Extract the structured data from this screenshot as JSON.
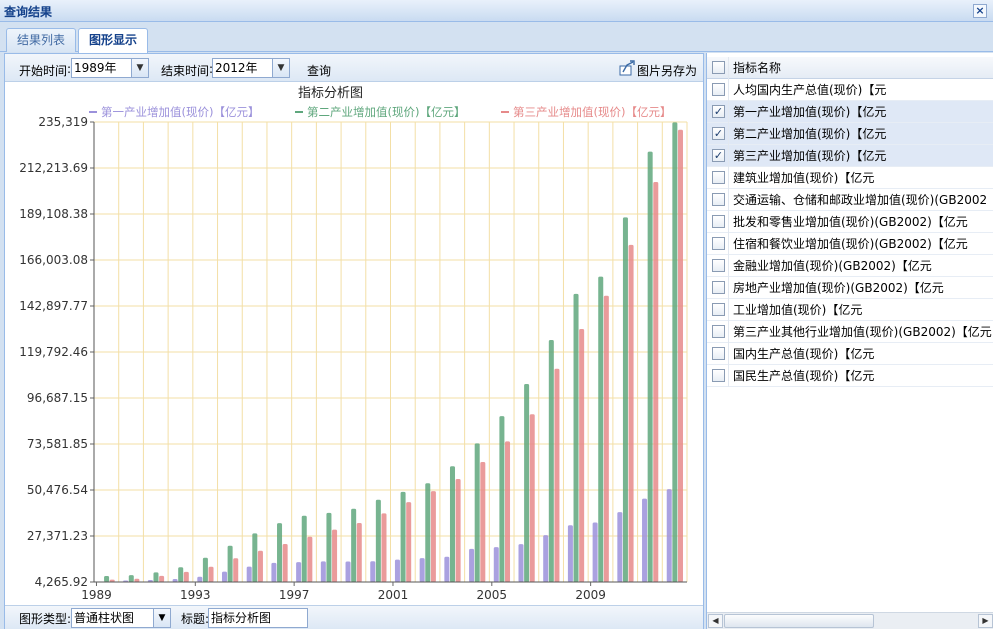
{
  "window": {
    "title": "查询结果",
    "close_icon": "close-icon"
  },
  "tabs": [
    {
      "label": "结果列表",
      "active": false
    },
    {
      "label": "图形显示",
      "active": true
    }
  ],
  "toolbar": {
    "start_label": "开始时间",
    "start_value": "1989年",
    "end_label": "结束时间",
    "end_value": "2012年",
    "query_label": "查询",
    "save_label": "图片另存为",
    "save_icon": "save-image-icon"
  },
  "bottombar": {
    "type_label": "图形类型:",
    "type_value": "普通柱状图",
    "title_label": "标题:",
    "title_value": "指标分析图"
  },
  "indicator_list": {
    "header": "指标名称",
    "items": [
      {
        "name": "人均国内生产总值(现价)【元",
        "checked": false
      },
      {
        "name": "第一产业增加值(现价)【亿元",
        "checked": true
      },
      {
        "name": "第二产业增加值(现价)【亿元",
        "checked": true
      },
      {
        "name": "第三产业增加值(现价)【亿元",
        "checked": true
      },
      {
        "name": "建筑业增加值(现价)【亿元",
        "checked": false
      },
      {
        "name": "交通运输、仓储和邮政业增加值(现价)(GB2002",
        "checked": false
      },
      {
        "name": "批发和零售业增加值(现价)(GB2002)【亿元",
        "checked": false
      },
      {
        "name": "住宿和餐饮业增加值(现价)(GB2002)【亿元",
        "checked": false
      },
      {
        "name": "金融业增加值(现价)(GB2002)【亿元",
        "checked": false
      },
      {
        "name": "房地产业增加值(现价)(GB2002)【亿元",
        "checked": false
      },
      {
        "name": "工业增加值(现价)【亿元",
        "checked": false
      },
      {
        "name": "第三产业其他行业增加值(现价)(GB2002)【亿元",
        "checked": false
      },
      {
        "name": "国内生产总值(现价)【亿元",
        "checked": false
      },
      {
        "name": "国民生产总值(现价)【亿元",
        "checked": false
      }
    ]
  },
  "chart_data": {
    "type": "bar",
    "title": "指标分析图",
    "categories": [
      "1989",
      "1990",
      "1991",
      "1992",
      "1993",
      "1994",
      "1995",
      "1996",
      "1997",
      "1998",
      "1999",
      "2000",
      "2001",
      "2002",
      "2003",
      "2004",
      "2005",
      "2006",
      "2007",
      "2008",
      "2009",
      "2010",
      "2011",
      "2012"
    ],
    "x_tick_labels": [
      "1989",
      "1993",
      "1997",
      "2001",
      "2005",
      "2009"
    ],
    "y_ticks": [
      "4,265.92",
      "27,371.23",
      "50,476.54",
      "73,581.85",
      "96,687.15",
      "119,792.46",
      "142,897.77",
      "166,003.08",
      "189,108.38",
      "212,213.69",
      "235,319"
    ],
    "ylim": [
      4265.92,
      235319
    ],
    "legend_position": "top",
    "grid": true,
    "series": [
      {
        "name": "第一产业增加值(现价)【亿元】",
        "color": "#9b91db",
        "values": [
          4228,
          5017,
          5289,
          5800,
          6887,
          9471,
          12020,
          13878,
          14265,
          14618,
          14548,
          14716,
          15516,
          16239,
          16970,
          20904,
          21807,
          23317,
          27788,
          32753,
          34161,
          39362,
          46163,
          50902
        ]
      },
      {
        "name": "第二产业增加值(现价)【亿元】",
        "color": "#5fa77d",
        "values": [
          7278,
          7717,
          9102,
          11699,
          16454,
          22445,
          28679,
          33835,
          37543,
          39004,
          41034,
          45556,
          49512,
          53897,
          62436,
          73904,
          87598,
          103720,
          125831,
          149003,
          157639,
          187383,
          220413,
          235162
        ]
      },
      {
        "name": "第三产业增加值(现价)【亿元】",
        "color": "#e68a8a",
        "values": [
          5448,
          5888,
          7337,
          9357,
          11916,
          16180,
          19978,
          23326,
          26988,
          30580,
          33873,
          38714,
          44362,
          49899,
          56005,
          64561,
          74919,
          88555,
          111352,
          131340,
          148038,
          173596,
          205205,
          231407
        ]
      }
    ]
  }
}
